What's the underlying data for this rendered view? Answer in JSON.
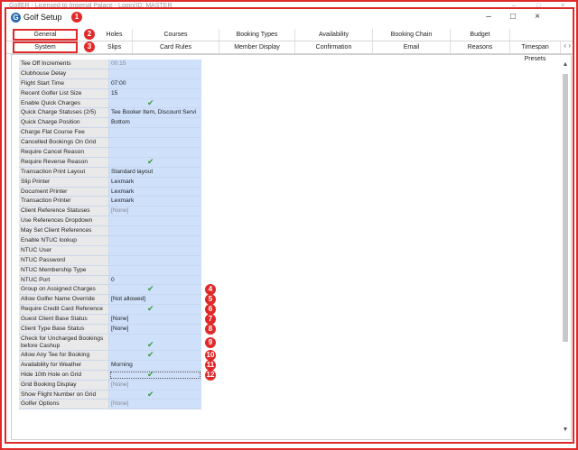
{
  "background": {
    "title": "GolfER - Licensed to Imperial Palace - Login(ID: MASTER",
    "controls": [
      "–",
      "□",
      "×"
    ]
  },
  "dialog": {
    "title": "Golf Setup",
    "controls": [
      "–",
      "□",
      "×"
    ]
  },
  "tabs_top": [
    "General",
    "Holes",
    "Courses",
    "Booking Types",
    "Availability",
    "Booking Chain",
    "Budget"
  ],
  "tabs_bottom": [
    "System",
    "Slips",
    "Card Rules",
    "Member Display",
    "Confirmation",
    "Email",
    "Reasons",
    "Timespan Presets"
  ],
  "tab_arrows": {
    "left": "‹",
    "right": "›"
  },
  "settings": [
    {
      "label": "Tee Off Increments",
      "value": "00:15",
      "muted": true
    },
    {
      "label": "Clubhouse Delay",
      "value": ""
    },
    {
      "label": "Flight Start Time",
      "value": "07:00"
    },
    {
      "label": "Recent Golfer List Size",
      "value": "15"
    },
    {
      "label": "Enable Quick Charges",
      "value": "✔"
    },
    {
      "label": "Quick Charge Statuses (2/5)",
      "value": "Tee Booker Item, Discount Servi"
    },
    {
      "label": "Quick Charge Position",
      "value": "Bottom"
    },
    {
      "label": "Charge Flat Course Fee",
      "value": ""
    },
    {
      "label": "Cancelled Bookings On Grid",
      "value": ""
    },
    {
      "label": "Require Cancel Reason",
      "value": ""
    },
    {
      "label": "Require Reverse Reason",
      "value": "✔"
    },
    {
      "label": "Transaction Print Layout",
      "value": "Standard layout"
    },
    {
      "label": "Slip Printer",
      "value": "Lexmark"
    },
    {
      "label": "Document Printer",
      "value": "Lexmark"
    },
    {
      "label": "Transaction Printer",
      "value": "Lexmark"
    },
    {
      "label": "Client Reference Statuses",
      "value": "[None]",
      "muted": true
    },
    {
      "label": "Use References Dropdown",
      "value": ""
    },
    {
      "label": "May Set Client References",
      "value": ""
    },
    {
      "label": "Enable NTUC lookup",
      "value": ""
    },
    {
      "label": "NTUC User",
      "value": ""
    },
    {
      "label": "NTUC Password",
      "value": ""
    },
    {
      "label": "NTUC Membership Type",
      "value": ""
    },
    {
      "label": "NTUC Port",
      "value": "0"
    },
    {
      "label": "Group on Assigned Charges",
      "value": "✔",
      "badge": "4"
    },
    {
      "label": "Allow Golfer Name Override",
      "value": "[Not allowed]",
      "badge": "5"
    },
    {
      "label": "Require Credit Card Reference",
      "value": "✔",
      "badge": "6"
    },
    {
      "label": "Guest Client Base Status",
      "value": "[None]",
      "badge": "7"
    },
    {
      "label": "Client Type Base Status",
      "value": "[None]",
      "badge": "8"
    },
    {
      "label": "Check for Uncharged Bookings before Cashup",
      "value": "✔",
      "badge": "9",
      "tall": true
    },
    {
      "label": "Allow Any Tee for Booking",
      "value": "✔",
      "badge": "10"
    },
    {
      "label": "Availability for Weather",
      "value": "Morning",
      "badge": "11"
    },
    {
      "label": "Hide 10th Hole on Grid",
      "value": "✔",
      "badge": "12",
      "focus": true
    },
    {
      "label": "Grid Booking Display",
      "value": "[None]",
      "muted": true
    },
    {
      "label": "Show Flight Number on Grid",
      "value": "✔"
    },
    {
      "label": "Golfer Options",
      "value": "[None]",
      "muted": true
    }
  ],
  "badges_header": [
    "1",
    "2",
    "3"
  ],
  "scrollbar": {
    "up": "▲",
    "down": "▼"
  }
}
